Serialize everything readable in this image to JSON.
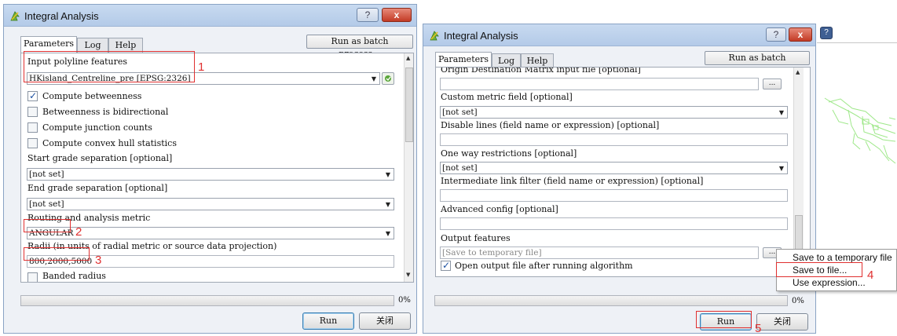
{
  "window1": {
    "title": "Integral Analysis",
    "help_btn": "?",
    "close_btn": "x",
    "tabs": [
      "Parameters",
      "Log",
      "Help"
    ],
    "batch_btn": "Run as batch process...",
    "params": {
      "input_label": "Input polyline features",
      "input_value": "HKisland_Centreline_pre [EPSG:2326]",
      "chk_betweenness": "Compute betweenness",
      "chk_bidirectional": "Betweenness is bidirectional",
      "chk_junction": "Compute junction counts",
      "chk_convex": "Compute convex hull statistics",
      "start_grade_label": "Start grade separation [optional]",
      "start_grade_value": "[not set]",
      "end_grade_label": "End grade separation [optional]",
      "end_grade_value": "[not set]",
      "metric_label": "Routing and analysis metric",
      "metric_value": "ANGULAR",
      "radii_label": "Radii (in units of radial metric or source data projection)",
      "radii_value": "800,2000,5000",
      "banded_label": "Banded radius"
    },
    "progress_pct": "0%",
    "progress_value": 0,
    "run_btn": "Run",
    "close_text_btn": "关闭",
    "annotations": [
      "1",
      "2",
      "3"
    ]
  },
  "window2": {
    "title": "Integral Analysis",
    "help_btn": "?",
    "close_btn": "x",
    "tabs": [
      "Parameters",
      "Log",
      "Help"
    ],
    "batch_btn": "Run as batch process...",
    "params": {
      "od_label": "Origin Destination Matrix input file [optional]",
      "od_dots": "...",
      "custom_metric_label": "Custom metric field [optional]",
      "custom_metric_value": "[not set]",
      "disable_label": "Disable lines (field name or expression) [optional]",
      "oneway_label": "One way restrictions [optional]",
      "oneway_value": "[not set]",
      "intermediate_label": "Intermediate link filter (field name or expression) [optional]",
      "advanced_label": "Advanced config [optional]",
      "output_label": "Output features",
      "output_placeholder": "[Save to temporary file]",
      "output_dots": "...",
      "open_output_label": "Open output file after running algorithm"
    },
    "progress_pct": "0%",
    "progress_value": 0,
    "run_btn": "Run",
    "close_text_btn": "关闭",
    "annotations": [
      "4",
      "5"
    ]
  },
  "context_menu": {
    "items": [
      "Save to a temporary file",
      "Save to file...",
      "Use expression..."
    ]
  },
  "bg_window": {
    "help_btn": "?"
  },
  "colors": {
    "annotation_red": "#e03030",
    "map_lines": "#9fe88a"
  }
}
